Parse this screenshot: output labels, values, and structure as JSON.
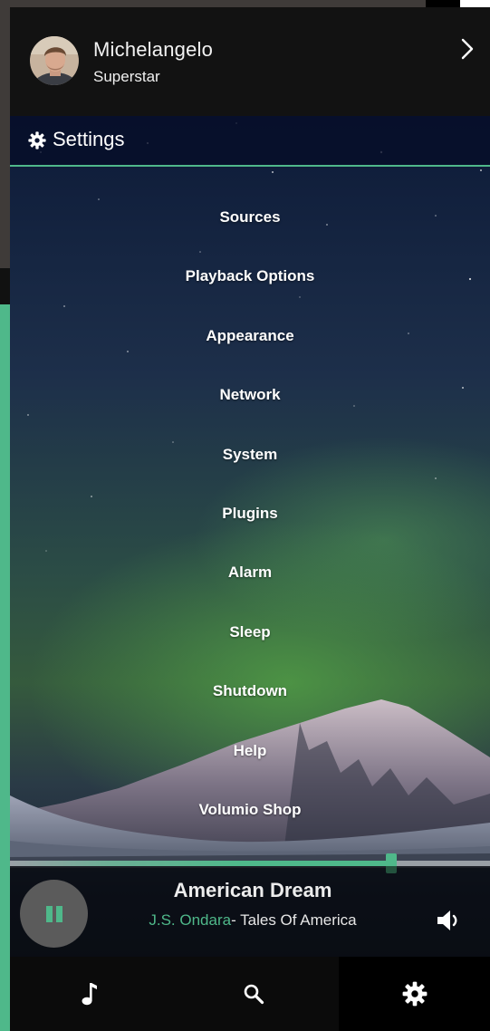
{
  "user": {
    "name": "Michelangelo",
    "role": "Superstar"
  },
  "settings": {
    "title": "Settings"
  },
  "menu": {
    "items": [
      "Sources",
      "Playback Options",
      "Appearance",
      "Network",
      "System",
      "Plugins",
      "Alarm",
      "Sleep",
      "Shutdown",
      "Help",
      "Volumio Shop"
    ]
  },
  "player": {
    "title": "American Dream",
    "artist": "J.S. Ondara",
    "album": "- Tales Of America",
    "progress_fraction": 0.795,
    "state": "playing"
  },
  "nav": {
    "items": [
      {
        "icon": "music-note-icon"
      },
      {
        "icon": "search-icon"
      },
      {
        "icon": "gear-icon",
        "active": true
      }
    ]
  },
  "colors": {
    "accent": "#4fb88a",
    "header_bg": "#121212",
    "nav_bg": "#0b0b0b"
  }
}
